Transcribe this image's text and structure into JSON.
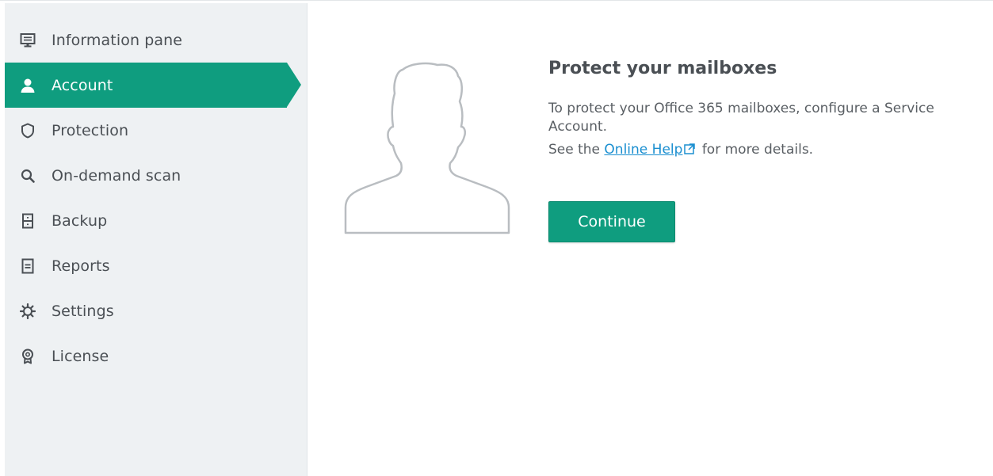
{
  "sidebar": {
    "items": [
      {
        "id": "information-pane",
        "label": "Information pane",
        "icon": "monitor-icon",
        "active": false
      },
      {
        "id": "account",
        "label": "Account",
        "icon": "person-icon",
        "active": true
      },
      {
        "id": "protection",
        "label": "Protection",
        "icon": "shield-icon",
        "active": false
      },
      {
        "id": "on-demand-scan",
        "label": "On-demand scan",
        "icon": "search-icon",
        "active": false
      },
      {
        "id": "backup",
        "label": "Backup",
        "icon": "backup-icon",
        "active": false
      },
      {
        "id": "reports",
        "label": "Reports",
        "icon": "report-icon",
        "active": false
      },
      {
        "id": "settings",
        "label": "Settings",
        "icon": "gear-icon",
        "active": false
      },
      {
        "id": "license",
        "label": "License",
        "icon": "license-icon",
        "active": false
      }
    ]
  },
  "main": {
    "title": "Protect your mailboxes",
    "description": "To protect your Office 365 mailboxes, configure a Service Account.",
    "help_prefix": "See the ",
    "help_link": "Online Help",
    "help_suffix": " for more details.",
    "continue_label": "Continue"
  },
  "colors": {
    "accent": "#0f9d7f",
    "sidebar_bg": "#eef1f3",
    "link": "#1b8fd0"
  }
}
